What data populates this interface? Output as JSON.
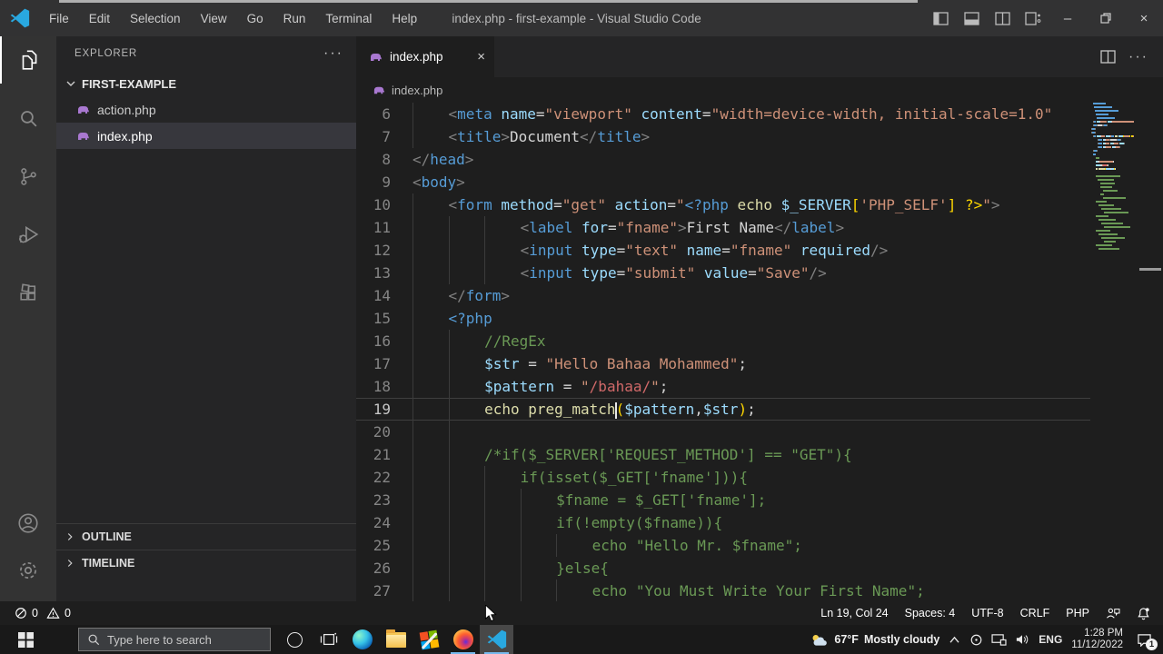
{
  "window": {
    "title": "index.php - first-example - Visual Studio Code"
  },
  "menu_bar": {
    "items": [
      "File",
      "Edit",
      "Selection",
      "View",
      "Go",
      "Run",
      "Terminal",
      "Help"
    ]
  },
  "icons": {
    "more": "···",
    "close": "×",
    "minimize": "–",
    "maximize": "❐"
  },
  "sidebar": {
    "title": "EXPLORER",
    "folder": "FIRST-EXAMPLE",
    "files": [
      {
        "name": "action.php"
      },
      {
        "name": "index.php"
      }
    ],
    "sections": [
      "OUTLINE",
      "TIMELINE"
    ]
  },
  "editor": {
    "tab": {
      "label": "index.php"
    },
    "breadcrumb": "index.php",
    "minimap": {
      "rows_above": 5,
      "rows_below": 14
    },
    "lines": [
      {
        "n": 6,
        "ind": 4,
        "tok": [
          [
            "pu",
            "<"
          ],
          [
            "tag",
            "meta"
          ],
          [
            "op",
            " "
          ],
          [
            "attr",
            "name"
          ],
          [
            "op",
            "="
          ],
          [
            "str",
            "\"viewport\""
          ],
          [
            "op",
            " "
          ],
          [
            "attr",
            "content"
          ],
          [
            "op",
            "="
          ],
          [
            "str",
            "\"width=device-width, initial-scale=1.0\""
          ]
        ]
      },
      {
        "n": 7,
        "ind": 4,
        "tok": [
          [
            "pu",
            "<"
          ],
          [
            "tag",
            "title"
          ],
          [
            "pu",
            ">"
          ],
          [
            "txt",
            "Document"
          ],
          [
            "pu",
            "</"
          ],
          [
            "tag",
            "title"
          ],
          [
            "pu",
            ">"
          ]
        ]
      },
      {
        "n": 8,
        "ind": 0,
        "tok": [
          [
            "pu",
            "</"
          ],
          [
            "tag",
            "head"
          ],
          [
            "pu",
            ">"
          ]
        ]
      },
      {
        "n": 9,
        "ind": 0,
        "tok": [
          [
            "pu",
            "<"
          ],
          [
            "tag",
            "body"
          ],
          [
            "pu",
            ">"
          ]
        ]
      },
      {
        "n": 10,
        "ind": 4,
        "tok": [
          [
            "pu",
            "<"
          ],
          [
            "tag",
            "form"
          ],
          [
            "op",
            " "
          ],
          [
            "attr",
            "method"
          ],
          [
            "op",
            "="
          ],
          [
            "str",
            "\"get\""
          ],
          [
            "op",
            " "
          ],
          [
            "attr",
            "action"
          ],
          [
            "op",
            "="
          ],
          [
            "str",
            "\""
          ],
          [
            "kw",
            "<?php"
          ],
          [
            "op",
            " "
          ],
          [
            "fn",
            "echo"
          ],
          [
            "op",
            " "
          ],
          [
            "var",
            "$_SERVER"
          ],
          [
            "br",
            "["
          ],
          [
            "str",
            "'PHP_SELF'"
          ],
          [
            "br",
            "]"
          ],
          [
            "op",
            " "
          ],
          [
            "br",
            "?>"
          ],
          [
            "str",
            "\""
          ],
          [
            "pu",
            ">"
          ]
        ]
      },
      {
        "n": 11,
        "ind": 12,
        "tok": [
          [
            "pu",
            "<"
          ],
          [
            "tag",
            "label"
          ],
          [
            "op",
            " "
          ],
          [
            "attr",
            "for"
          ],
          [
            "op",
            "="
          ],
          [
            "str",
            "\"fname\""
          ],
          [
            "pu",
            ">"
          ],
          [
            "txt",
            "First Name"
          ],
          [
            "pu",
            "</"
          ],
          [
            "tag",
            "label"
          ],
          [
            "pu",
            ">"
          ]
        ]
      },
      {
        "n": 12,
        "ind": 12,
        "tok": [
          [
            "pu",
            "<"
          ],
          [
            "tag",
            "input"
          ],
          [
            "op",
            " "
          ],
          [
            "attr",
            "type"
          ],
          [
            "op",
            "="
          ],
          [
            "str",
            "\"text\""
          ],
          [
            "op",
            " "
          ],
          [
            "attr",
            "name"
          ],
          [
            "op",
            "="
          ],
          [
            "str",
            "\"fname\""
          ],
          [
            "op",
            " "
          ],
          [
            "attr",
            "required"
          ],
          [
            "pu",
            "/>"
          ]
        ]
      },
      {
        "n": 13,
        "ind": 12,
        "tok": [
          [
            "pu",
            "<"
          ],
          [
            "tag",
            "input"
          ],
          [
            "op",
            " "
          ],
          [
            "attr",
            "type"
          ],
          [
            "op",
            "="
          ],
          [
            "str",
            "\"submit\""
          ],
          [
            "op",
            " "
          ],
          [
            "attr",
            "value"
          ],
          [
            "op",
            "="
          ],
          [
            "str",
            "\"Save\""
          ],
          [
            "pu",
            "/>"
          ]
        ]
      },
      {
        "n": 14,
        "ind": 4,
        "tok": [
          [
            "pu",
            "</"
          ],
          [
            "tag",
            "form"
          ],
          [
            "pu",
            ">"
          ]
        ]
      },
      {
        "n": 15,
        "ind": 4,
        "tok": [
          [
            "kw",
            "<?php"
          ]
        ]
      },
      {
        "n": 16,
        "ind": 8,
        "tok": [
          [
            "com",
            "//RegEx"
          ]
        ]
      },
      {
        "n": 17,
        "ind": 8,
        "tok": [
          [
            "var",
            "$str"
          ],
          [
            "op",
            " = "
          ],
          [
            "str",
            "\"Hello Bahaa Mohammed\""
          ],
          [
            "op",
            ";"
          ]
        ]
      },
      {
        "n": 18,
        "ind": 8,
        "tok": [
          [
            "var",
            "$pattern"
          ],
          [
            "op",
            " = "
          ],
          [
            "str",
            "\""
          ],
          [
            "re",
            "/bahaa/"
          ],
          [
            "str",
            "\""
          ],
          [
            "op",
            ";"
          ]
        ]
      },
      {
        "n": 19,
        "ind": 8,
        "cur": true,
        "tok": [
          [
            "fn",
            "echo"
          ],
          [
            "op",
            " "
          ],
          [
            "fn",
            "preg_match"
          ],
          [
            "cursor",
            ""
          ],
          [
            "br",
            "("
          ],
          [
            "var",
            "$pattern"
          ],
          [
            "op",
            ","
          ],
          [
            "var",
            "$str"
          ],
          [
            "br",
            ")"
          ],
          [
            "op",
            ";"
          ]
        ]
      },
      {
        "n": 20,
        "ind": 8,
        "tok": []
      },
      {
        "n": 21,
        "ind": 8,
        "tok": [
          [
            "com",
            "/*if($_SERVER['REQUEST_METHOD'] == \"GET\"){"
          ]
        ]
      },
      {
        "n": 22,
        "ind": 12,
        "tok": [
          [
            "com",
            "if(isset($_GET['fname'])){"
          ]
        ]
      },
      {
        "n": 23,
        "ind": 16,
        "tok": [
          [
            "com",
            "$fname = $_GET['fname'];"
          ]
        ]
      },
      {
        "n": 24,
        "ind": 16,
        "tok": [
          [
            "com",
            "if(!empty($fname)){"
          ]
        ]
      },
      {
        "n": 25,
        "ind": 20,
        "tok": [
          [
            "com",
            "echo \"Hello Mr. $fname\";"
          ]
        ]
      },
      {
        "n": 26,
        "ind": 16,
        "tok": [
          [
            "com",
            "}else{"
          ]
        ]
      },
      {
        "n": 27,
        "ind": 20,
        "tok": [
          [
            "com",
            "echo \"You Must Write Your First Name\";"
          ]
        ]
      }
    ]
  },
  "status_bar": {
    "errors": "0",
    "warnings": "0",
    "line_col": "Ln 19, Col 24",
    "indent": "Spaces: 4",
    "encoding": "UTF-8",
    "eol": "CRLF",
    "language": "PHP"
  },
  "taskbar": {
    "search_placeholder": "Type here to search",
    "weather_temp": "67°F",
    "weather_desc": "Mostly cloudy",
    "language": "ENG",
    "time": "1:28 PM",
    "date": "11/12/2022",
    "notification_badge": "1"
  },
  "colors": {
    "status_bar_bg": "#007acc",
    "titlebar_bg": "#323233",
    "editor_bg": "#1e1e1e",
    "sidebar_bg": "#252526",
    "php_icon": "#a978d1",
    "vscode_blue": "#29a8e0",
    "minimap_above": "#569cd6",
    "minimap_below": "#6a9955",
    "tokens": {
      "pu": "#808080",
      "tag": "#569cd6",
      "attr": "#9cdcfe",
      "str": "#ce9178",
      "txt": "#d4d4d4",
      "kw": "#569cd6",
      "fn": "#dcdcaa",
      "var": "#9cdcfe",
      "op": "#d4d4d4",
      "com": "#6a9955",
      "re": "#d16969",
      "br": "#ffd700"
    }
  }
}
